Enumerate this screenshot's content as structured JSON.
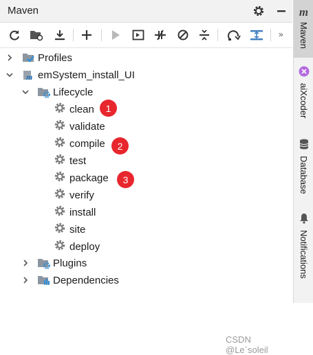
{
  "panel": {
    "title": "Maven"
  },
  "tree": {
    "profiles": "Profiles",
    "project": "emSystem_install_UI",
    "lifecycle": "Lifecycle",
    "phases": [
      "clean",
      "validate",
      "compile",
      "test",
      "package",
      "verify",
      "install",
      "site",
      "deploy"
    ],
    "plugins": "Plugins",
    "dependencies": "Dependencies"
  },
  "badges": [
    "1",
    "2",
    "3"
  ],
  "right_tabs": {
    "maven": "Maven",
    "aixcoder": "aiXcoder",
    "database": "Database",
    "notifications": "Notifications"
  },
  "right_logo": "m",
  "toolbar": {
    "more": "»"
  },
  "watermark": "CSDN @Le`soleil",
  "colors": {
    "badge": "#e8262d",
    "gear": "#7a7a7a",
    "active_tab": "#d3d3d3"
  }
}
